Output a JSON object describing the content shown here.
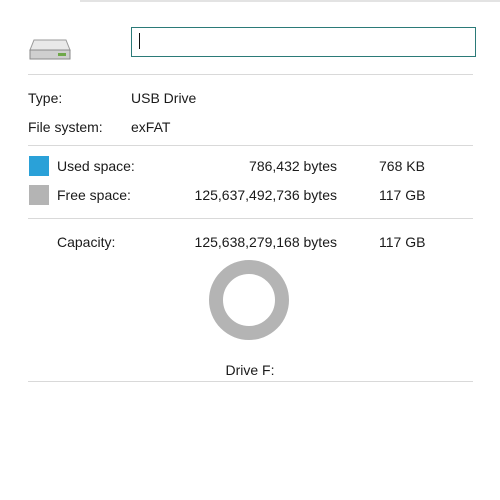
{
  "colors": {
    "used": "#2aa1d8",
    "free": "#b4b4b4",
    "accent_border": "#2b7a78"
  },
  "icons": {
    "drive": "usb-drive-icon"
  },
  "name_field": {
    "value": ""
  },
  "info": {
    "type_label": "Type:",
    "type_value": "USB Drive",
    "fs_label": "File system:",
    "fs_value": "exFAT"
  },
  "space": {
    "used_label": "Used space:",
    "used_bytes": "786,432 bytes",
    "used_short": "768 KB",
    "free_label": "Free space:",
    "free_bytes": "125,637,492,736 bytes",
    "free_short": "117 GB",
    "capacity_label": "Capacity:",
    "capacity_bytes": "125,638,279,168 bytes",
    "capacity_short": "117 GB",
    "used_fraction": 6.26e-06
  },
  "drive_label": "Drive F:"
}
